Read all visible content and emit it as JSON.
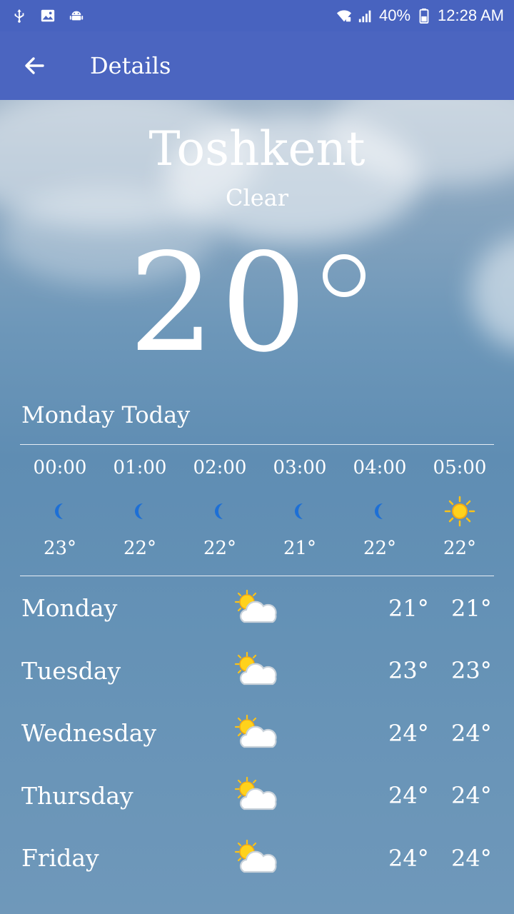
{
  "status_bar": {
    "battery": "40%",
    "time": "12:28 AM",
    "left_icons": [
      "usb-icon",
      "image-icon",
      "android-icon"
    ],
    "right_icons": [
      "wifi-icon",
      "signal-icon",
      "battery-icon"
    ]
  },
  "app_bar": {
    "title": "Details"
  },
  "current": {
    "city": "Toshkent",
    "condition": "Clear",
    "temperature": "20"
  },
  "today_label": "Monday Today",
  "hourly": [
    {
      "time": "00:00",
      "icon": "moon-icon",
      "temp": "23°"
    },
    {
      "time": "01:00",
      "icon": "moon-icon",
      "temp": "22°"
    },
    {
      "time": "02:00",
      "icon": "moon-icon",
      "temp": "22°"
    },
    {
      "time": "03:00",
      "icon": "moon-icon",
      "temp": "21°"
    },
    {
      "time": "04:00",
      "icon": "moon-icon",
      "temp": "22°"
    },
    {
      "time": "05:00",
      "icon": "sun-icon",
      "temp": "22°"
    }
  ],
  "daily": [
    {
      "day": "Monday",
      "icon": "partly-cloudy-icon",
      "max": "21°",
      "min": "21°"
    },
    {
      "day": "Tuesday",
      "icon": "partly-cloudy-icon",
      "max": "23°",
      "min": "23°"
    },
    {
      "day": "Wednesday",
      "icon": "partly-cloudy-icon",
      "max": "24°",
      "min": "24°"
    },
    {
      "day": "Thursday",
      "icon": "partly-cloudy-icon",
      "max": "24°",
      "min": "24°"
    },
    {
      "day": "Friday",
      "icon": "partly-cloudy-icon",
      "max": "24°",
      "min": "24°"
    }
  ],
  "colors": {
    "app_bar": "#4b65c0",
    "status_bar": "#4863bf",
    "moon": "#1d6fd6",
    "sun": "#f8c21a"
  }
}
